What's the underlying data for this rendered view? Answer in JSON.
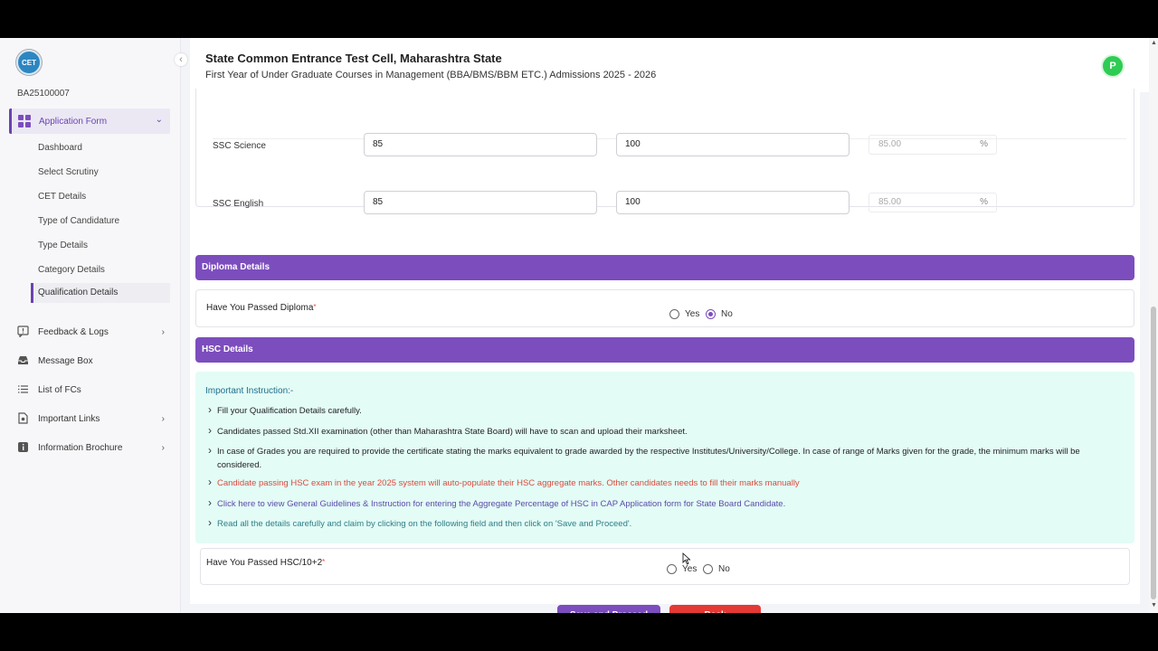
{
  "sidebar": {
    "logo_text": "CET",
    "user_id": "BA25100007",
    "active_section": "Application Form",
    "sub_items": [
      "Dashboard",
      "Select Scrutiny",
      "CET Details",
      "Type of Candidature",
      "Type Details",
      "Category Details"
    ],
    "active_sub_item": "Qualification Details",
    "nav_items": [
      {
        "label": "Feedback & Logs",
        "icon": "feedback-icon",
        "has_chevron": true
      },
      {
        "label": "Message Box",
        "icon": "message-icon",
        "has_chevron": false
      },
      {
        "label": "List of FCs",
        "icon": "list-icon",
        "has_chevron": false
      },
      {
        "label": "Important Links",
        "icon": "link-icon",
        "has_chevron": true
      },
      {
        "label": "Information Brochure",
        "icon": "info-icon",
        "has_chevron": true
      }
    ]
  },
  "header": {
    "title": "State Common Entrance Test Cell, Maharashtra State",
    "subtitle": "First Year of Under Graduate Courses in Management (BBA/BMS/BBM ETC.) Admissions 2025 - 2026",
    "avatar_letter": "P"
  },
  "ssc_rows": [
    {
      "subject": "SSC Science",
      "marks_obtained": "85",
      "marks_out_of": "100",
      "percentage": "85.00",
      "pct_symbol": "%"
    },
    {
      "subject": "SSC English",
      "marks_obtained": "85",
      "marks_out_of": "100",
      "percentage": "85.00",
      "pct_symbol": "%"
    }
  ],
  "diploma": {
    "section_title": "Diploma Details",
    "question": "Have You Passed Diploma",
    "required_mark": "*",
    "options": [
      "Yes",
      "No"
    ],
    "selected": "No"
  },
  "hsc": {
    "section_title": "HSC Details",
    "instruction_title": "Important Instruction:-",
    "instructions": [
      "Fill your Qualification Details carefully.",
      "Candidates passed Std.XII examination (other than Maharashtra State Board) will have to scan and upload their marksheet.",
      "In case of Grades you are required to provide the certificate stating the marks equivalent to grade awarded by the respective Institutes/University/College. In case of range of Marks given for the grade, the minimum marks will be considered.",
      "Candidate passing HSC exam in the year 2025 system will auto-populate their HSC aggregate marks. Other candidates needs to fill their marks manually",
      "Click here to view General Guidelines & Instruction for entering the Aggregate Percentage of HSC in CAP Application form for State Board Candidate.",
      "Read all the details carefully and claim by clicking on the following field and then click on 'Save and Proceed'."
    ],
    "question": "Have You Passed HSC/10+2",
    "required_mark": "*",
    "options": [
      "Yes",
      "No"
    ],
    "selected": ""
  },
  "actions": {
    "save_label": "Save and Proceed",
    "back_label": "Back"
  },
  "colors": {
    "primary": "#7c4dbd",
    "danger": "#e53935",
    "instruction_bg": "#e3fcf6",
    "avatar": "#2ecc52"
  }
}
